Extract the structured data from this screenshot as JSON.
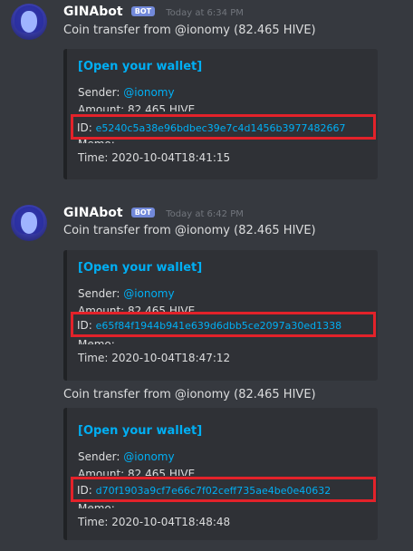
{
  "messages": [
    {
      "author": "GINAbot",
      "bot_tag": "BOT",
      "timestamp": "Today at 6:34 PM",
      "text": "Coin transfer from @ionomy (82.465 HIVE)",
      "embed": {
        "title": "[Open your wallet]",
        "sender_label": "Sender: ",
        "sender": "@ionomy",
        "amount": "Amount: 82.465 HIVE",
        "id_label": "ID: ",
        "id": "e5240c5a38e96bdbec39e7c4d1456b3977482667",
        "memo": "Memo:",
        "time": "Time: 2020-10-04T18:41:15"
      }
    },
    {
      "author": "GINAbot",
      "bot_tag": "BOT",
      "timestamp": "Today at 6:42 PM",
      "text": "Coin transfer from @ionomy (82.465 HIVE)",
      "embed": {
        "title": "[Open your wallet]",
        "sender_label": "Sender: ",
        "sender": "@ionomy",
        "amount": "Amount: 82.465 HIVE",
        "id_label": "ID: ",
        "id": "e65f84f1944b941e639d6dbb5ce2097a30ed1338",
        "memo": "Memo:",
        "time": "Time: 2020-10-04T18:47:12"
      }
    },
    {
      "text": "Coin transfer from @ionomy (82.465 HIVE)",
      "embed": {
        "title": "[Open your wallet]",
        "sender_label": "Sender: ",
        "sender": "@ionomy",
        "amount": "Amount: 82.465 HIVE",
        "id_label": "ID: ",
        "id": "d70f1903a9cf7e66c7f02ceff735ae4be0e40632",
        "memo": "Memo:",
        "time": "Time: 2020-10-04T18:48:48"
      }
    }
  ],
  "colors": {
    "background": "#36393f",
    "embed_background": "#2f3136",
    "link": "#00aff4",
    "highlight_box": "#e3222a",
    "bot_tag": "#7289da"
  }
}
